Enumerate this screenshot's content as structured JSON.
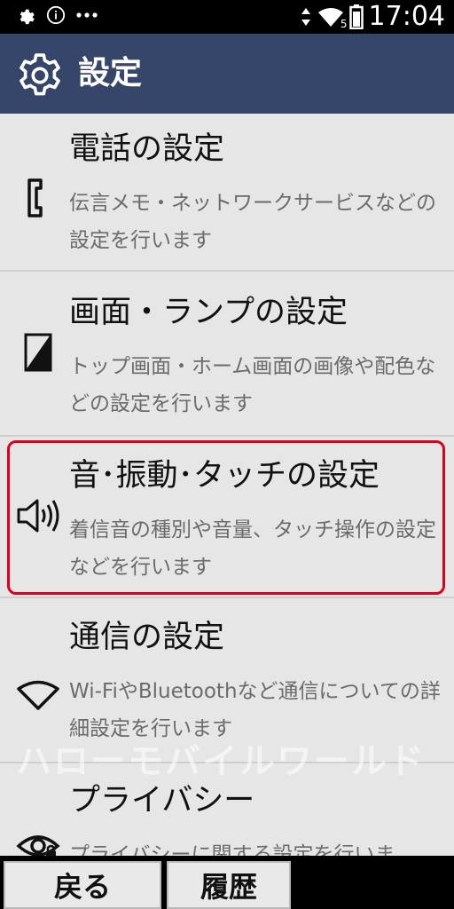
{
  "status_bar": {
    "time": "17:04",
    "left_icons": [
      "gear-icon",
      "info-icon",
      "more-icon"
    ],
    "right_icons": [
      "vibrate-icon",
      "wifi-icon",
      "battery-icon"
    ],
    "wifi_badge": "5"
  },
  "header": {
    "title": "設定",
    "background": "#36466a"
  },
  "list": {
    "items": [
      {
        "title": "電話の設定",
        "desc": "伝言メモ・ネットワークサービスなどの設定を行います",
        "icon": "phone-icon",
        "selected": false
      },
      {
        "title": "画面・ランプの設定",
        "desc": "トップ画面・ホーム画面の画像や配色などの設定を行います",
        "icon": "screen-icon",
        "selected": false
      },
      {
        "title": "音･振動･タッチの設定",
        "desc": "着信音の種別や音量、タッチ操作の設定などを行います",
        "icon": "speaker-icon",
        "selected": true
      },
      {
        "title": "通信の設定",
        "desc": "Wi-FiやBluetoothなど通信についての詳細設定を行います",
        "icon": "wifi-icon",
        "selected": false
      },
      {
        "title": "プライバシー",
        "desc": "プライバシーに関する設定を行いま",
        "icon": "privacy-eye-icon",
        "selected": false
      }
    ],
    "selection_color": "#e0001b"
  },
  "watermark": "ハローモバイルワールド",
  "navbar": {
    "back_label": "戻る",
    "history_label": "履歴"
  }
}
